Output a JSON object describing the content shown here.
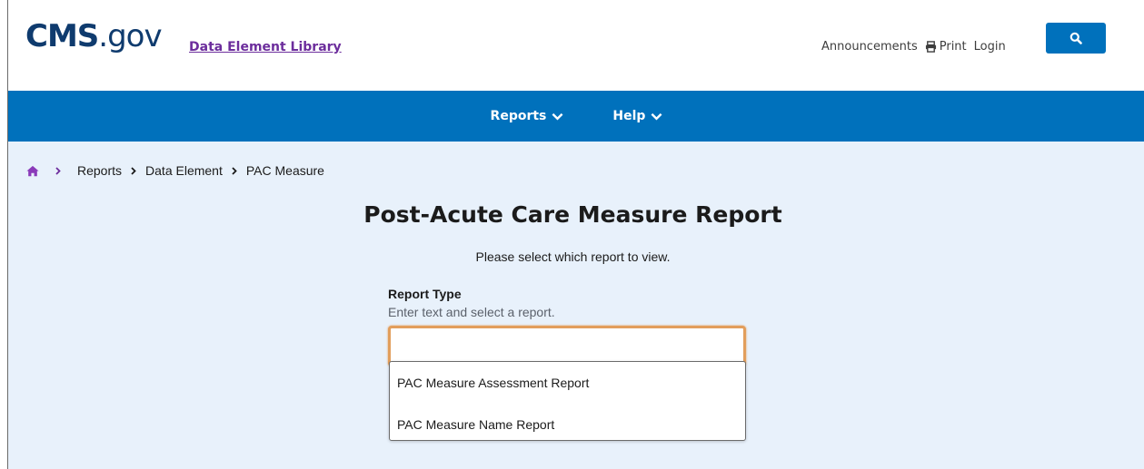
{
  "header": {
    "logo_main": "CMS",
    "logo_suffix": ".gov",
    "library_link": "Data Element Library",
    "util_links": {
      "announcements": "Announcements",
      "print": "Print",
      "login": "Login"
    },
    "search_icon": "search-icon"
  },
  "navbar": {
    "items": [
      {
        "label": "Reports"
      },
      {
        "label": "Help"
      }
    ]
  },
  "breadcrumb": {
    "items": [
      "Reports",
      "Data Element",
      "PAC Measure"
    ]
  },
  "main": {
    "title": "Post-Acute Care Measure Report",
    "subtitle": "Please select which report to view.",
    "field_label": "Report Type",
    "field_hint": "Enter text and select a report.",
    "input_value": "",
    "options": [
      "PAC Measure Assessment Report",
      "PAC Measure Name Report"
    ]
  },
  "colors": {
    "brand_blue": "#0071bc",
    "link_purple": "#6c2d9c",
    "page_bg": "#e8f1fb",
    "focus_orange": "#e29e5c"
  }
}
